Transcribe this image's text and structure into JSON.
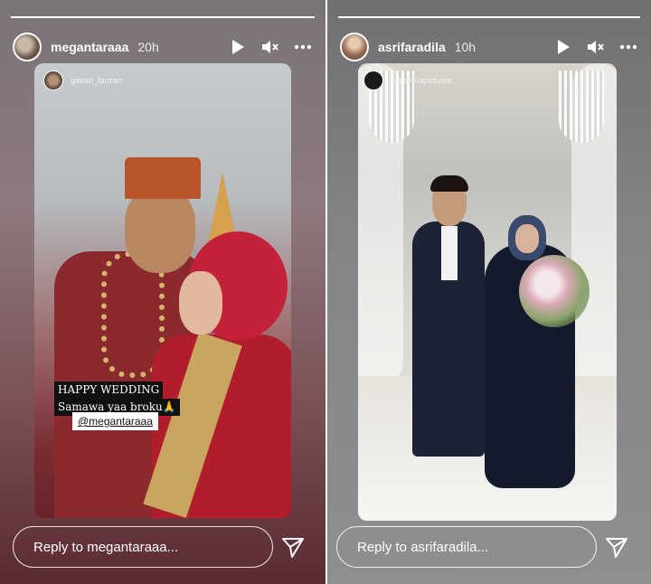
{
  "stories": [
    {
      "username": "megantaraaa",
      "time": "20h",
      "tagged_user": "gibran_fauzan",
      "caption_line1": "HAPPY WEDDING",
      "caption_line2": "Samawa yaa broku🙏",
      "mention": "@megantaraaa",
      "reply_placeholder": "Reply to megantaraaa..."
    },
    {
      "username": "asrifaradila",
      "time": "10h",
      "tagged_user": "maximuspictures",
      "reply_placeholder": "Reply to asrifaradila..."
    }
  ],
  "icons": {
    "play": "play-icon",
    "mute": "speaker-muted-icon",
    "more": "more-options-icon",
    "send": "send-icon"
  },
  "colors": {
    "left_panel_base": "#7a4f55",
    "right_panel_base": "#838486",
    "text": "#ffffff"
  }
}
